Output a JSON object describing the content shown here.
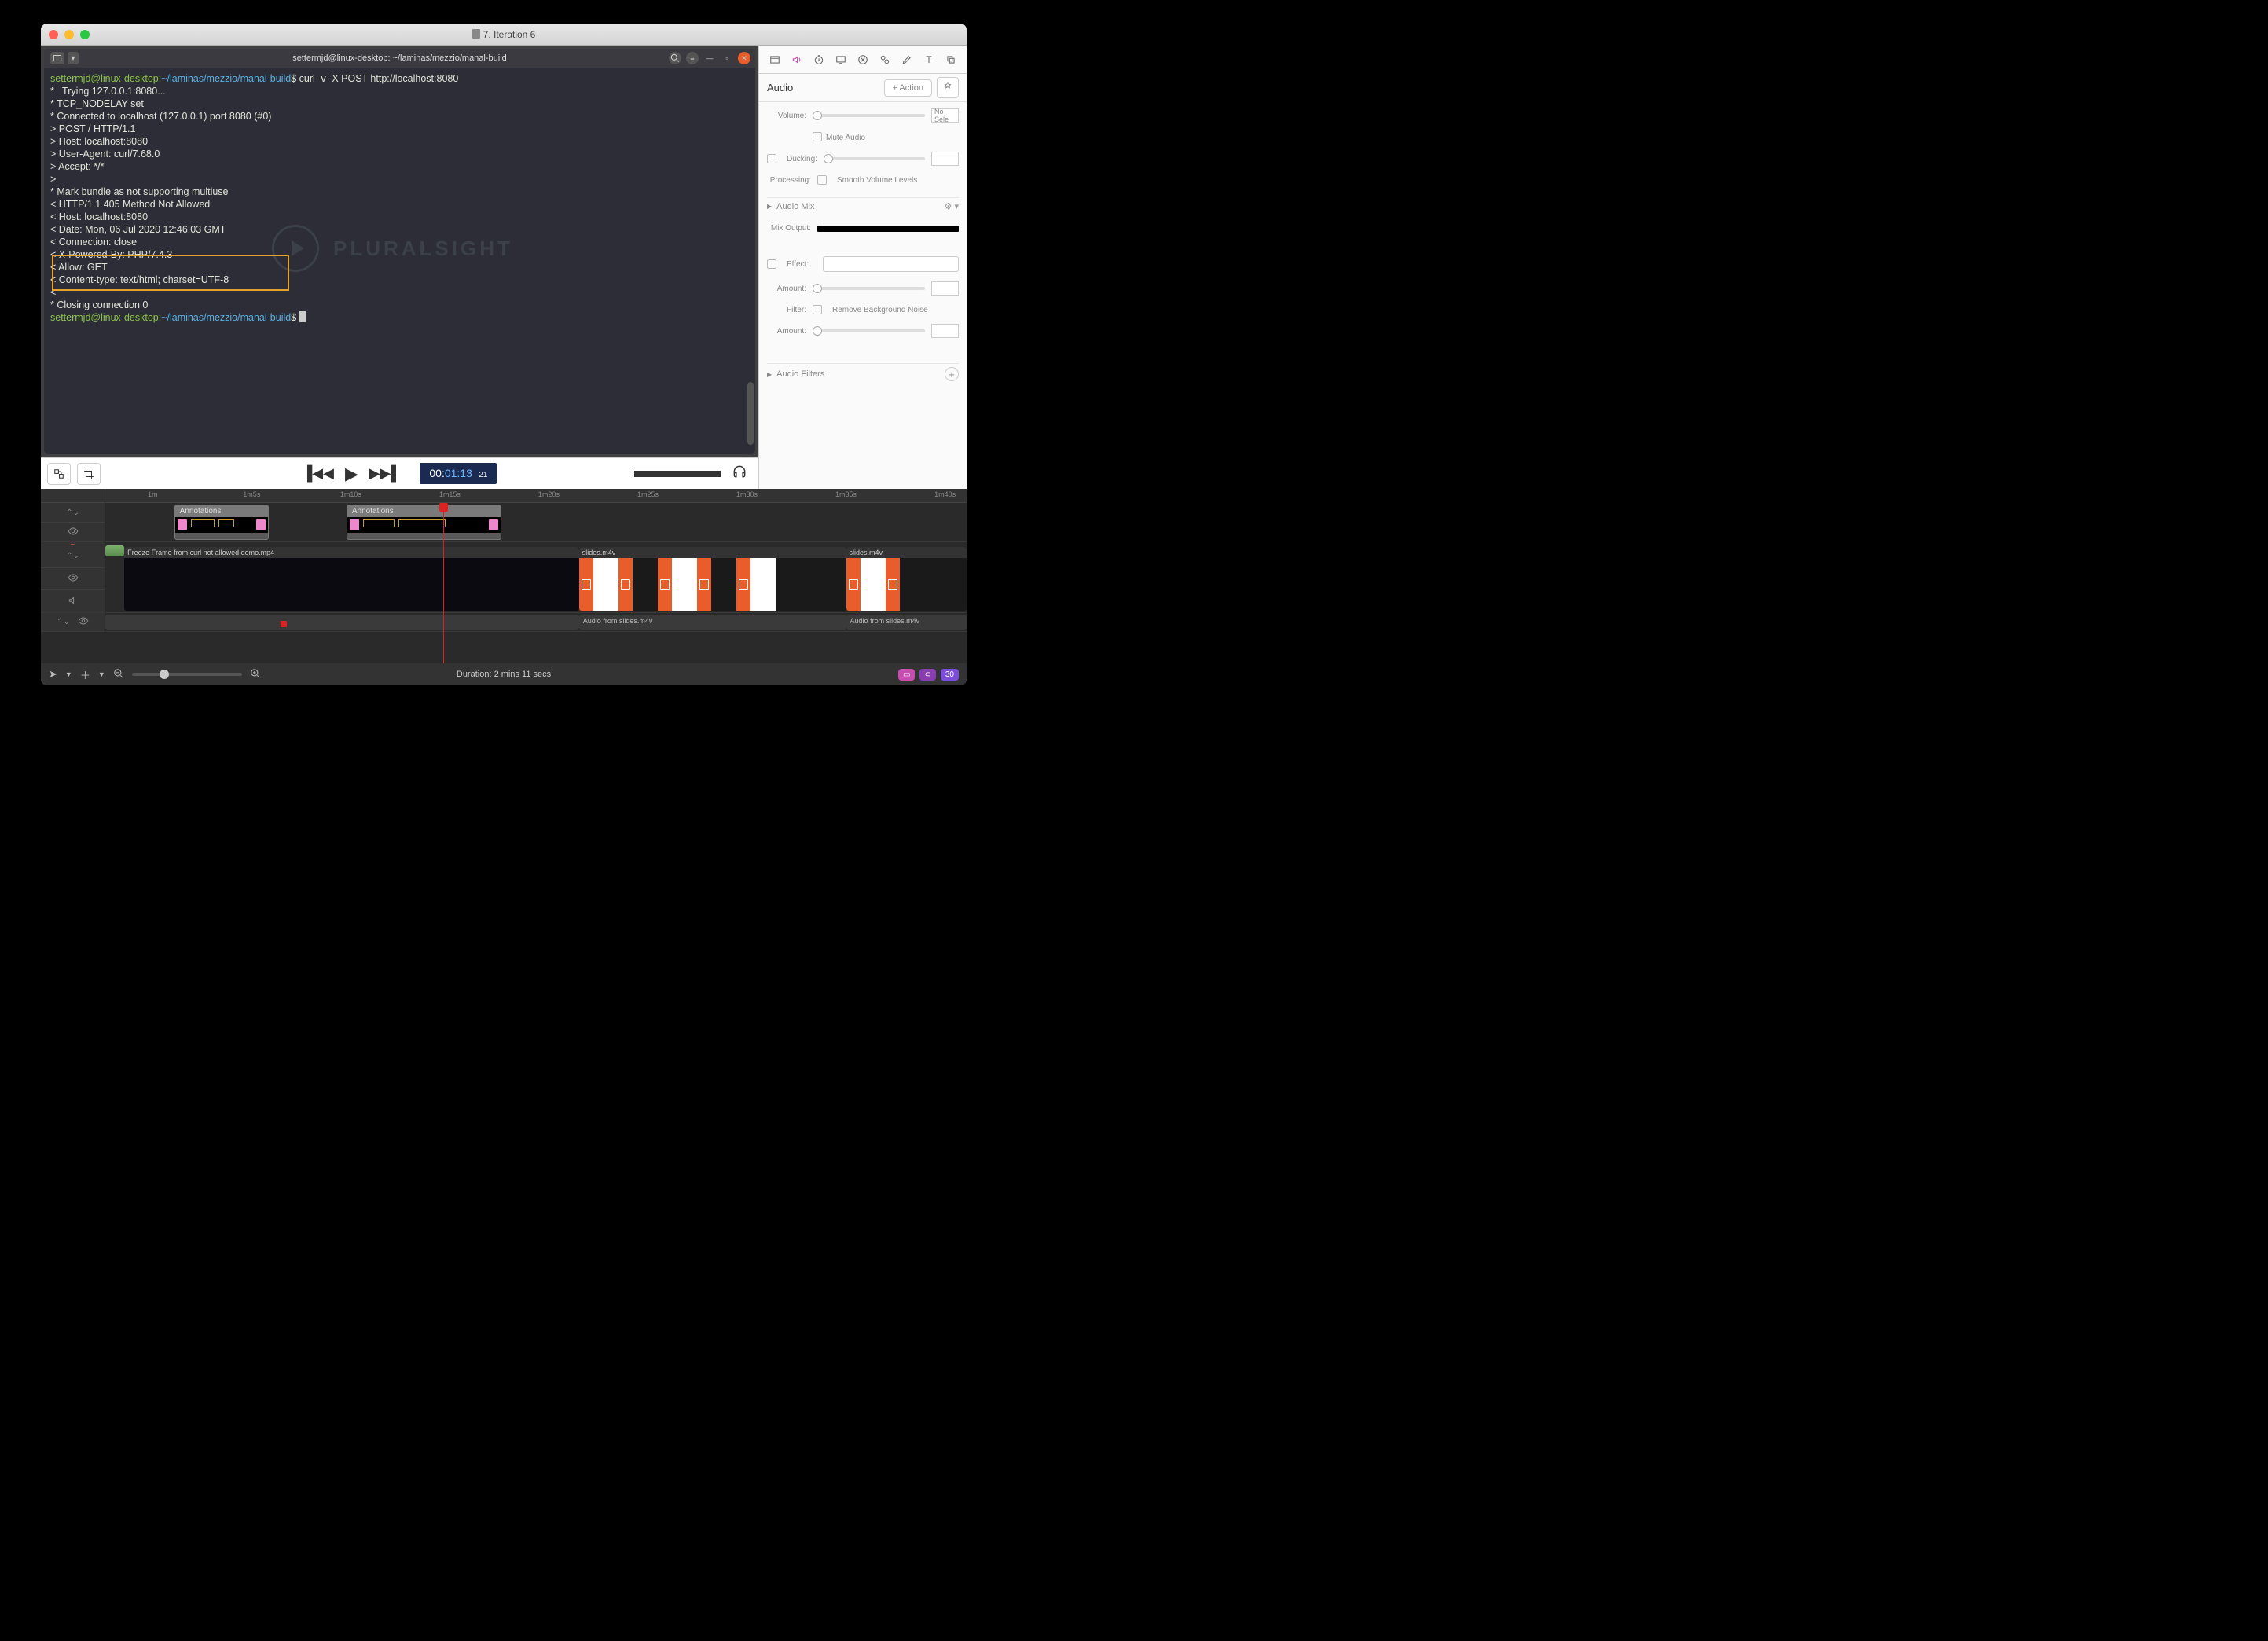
{
  "window": {
    "title": "7. Iteration 6"
  },
  "terminal": {
    "title": "settermjd@linux-desktop: ~/laminas/mezzio/manal-build",
    "prompt_user": "settermjd@linux-desktop:",
    "prompt_path": "~/laminas/mezzio/manal-build",
    "prompt_symbol": "$",
    "command": "curl -v -X POST http://localhost:8080",
    "lines": [
      "*   Trying 127.0.0.1:8080...",
      "* TCP_NODELAY set",
      "* Connected to localhost (127.0.0.1) port 8080 (#0)",
      "> POST / HTTP/1.1",
      "> Host: localhost:8080",
      "> User-Agent: curl/7.68.0",
      "> Accept: */*",
      ">",
      "* Mark bundle as not supporting multiuse",
      "< HTTP/1.1 405 Method Not Allowed",
      "< Host: localhost:8080",
      "< Date: Mon, 06 Jul 2020 12:46:03 GMT",
      "< Connection: close",
      "< X-Powered-By: PHP/7.4.3",
      "< Allow: GET",
      "< Content-type: text/html; charset=UTF-8",
      "<",
      "* Closing connection 0"
    ],
    "watermark": "PLURALSIGHT"
  },
  "playbar": {
    "timecode_prefix": "00:",
    "timecode_main": "01:13",
    "timecode_frames": "21"
  },
  "timeline": {
    "ruler": [
      "1m",
      "1m5s",
      "1m10s",
      "1m15s",
      "1m20s",
      "1m25s",
      "1m30s",
      "1m35s",
      "1m40s"
    ],
    "annotations_label": "Annotations",
    "video_clip_1": "Freeze Frame from curl not allowed demo.mp4",
    "video_clip_2": "slides.m4v",
    "video_clip_3": "slides.m4v",
    "audio_clip_1": "Audio from slides.m4v",
    "audio_clip_2": "Audio from slides.m4v"
  },
  "bottombar": {
    "duration": "Duration: 2 mins 11 secs",
    "pill": "30"
  },
  "inspector": {
    "title": "Audio",
    "action_btn": "+ Action",
    "volume_label": "Volume:",
    "volume_val": "No Sele",
    "mute": "Mute Audio",
    "ducking_label": "Ducking:",
    "processing_label": "Processing:",
    "smooth": "Smooth Volume Levels",
    "audiomix": "Audio Mix",
    "mixoutput": "Mix Output:",
    "effect_label": "Effect:",
    "amount_label": "Amount:",
    "filter_label": "Filter:",
    "noise": "Remove Background Noise",
    "amount2_label": "Amount:",
    "audiofilters": "Audio Filters"
  }
}
